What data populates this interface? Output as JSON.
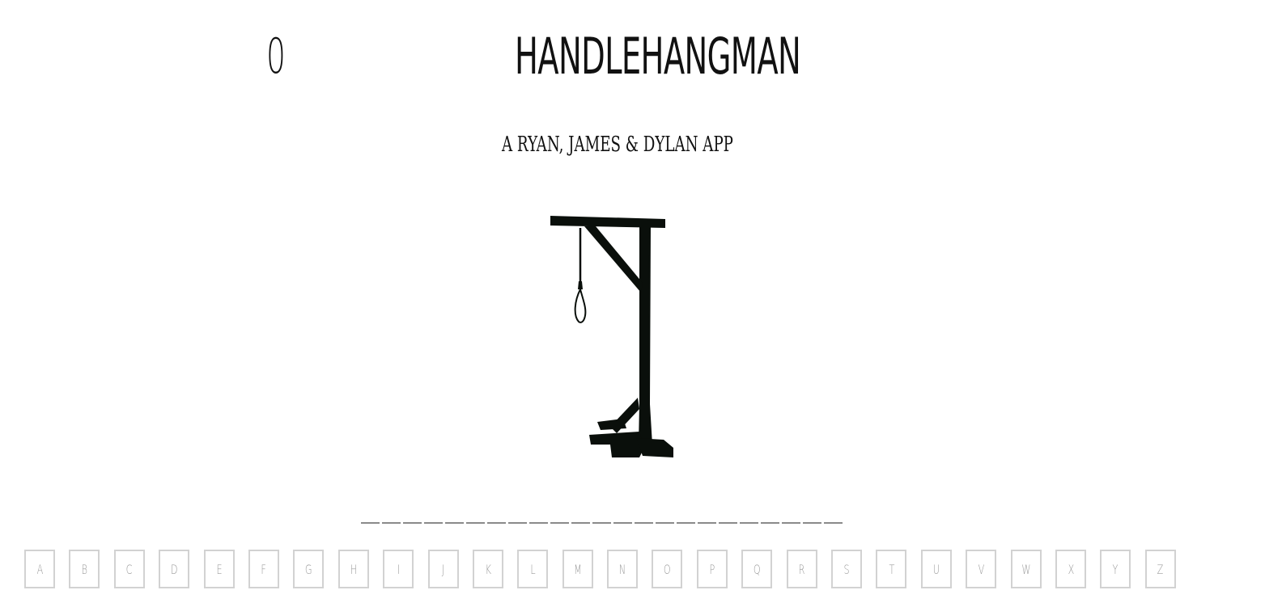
{
  "header": {
    "score": "0",
    "title": "HANDLEHANGMAN",
    "subtitle": "A RYAN, JAMES & DYLAN APP"
  },
  "gallows": {
    "image": "gallows-with-noose",
    "color": "#0a0f0b"
  },
  "word": {
    "blank_count": 23
  },
  "keyboard": {
    "letters": [
      "A",
      "B",
      "C",
      "D",
      "E",
      "F",
      "G",
      "H",
      "I",
      "J",
      "K",
      "L",
      "M",
      "N",
      "O",
      "P",
      "Q",
      "R",
      "S",
      "T",
      "U",
      "V",
      "W",
      "X",
      "Y",
      "Z"
    ]
  }
}
